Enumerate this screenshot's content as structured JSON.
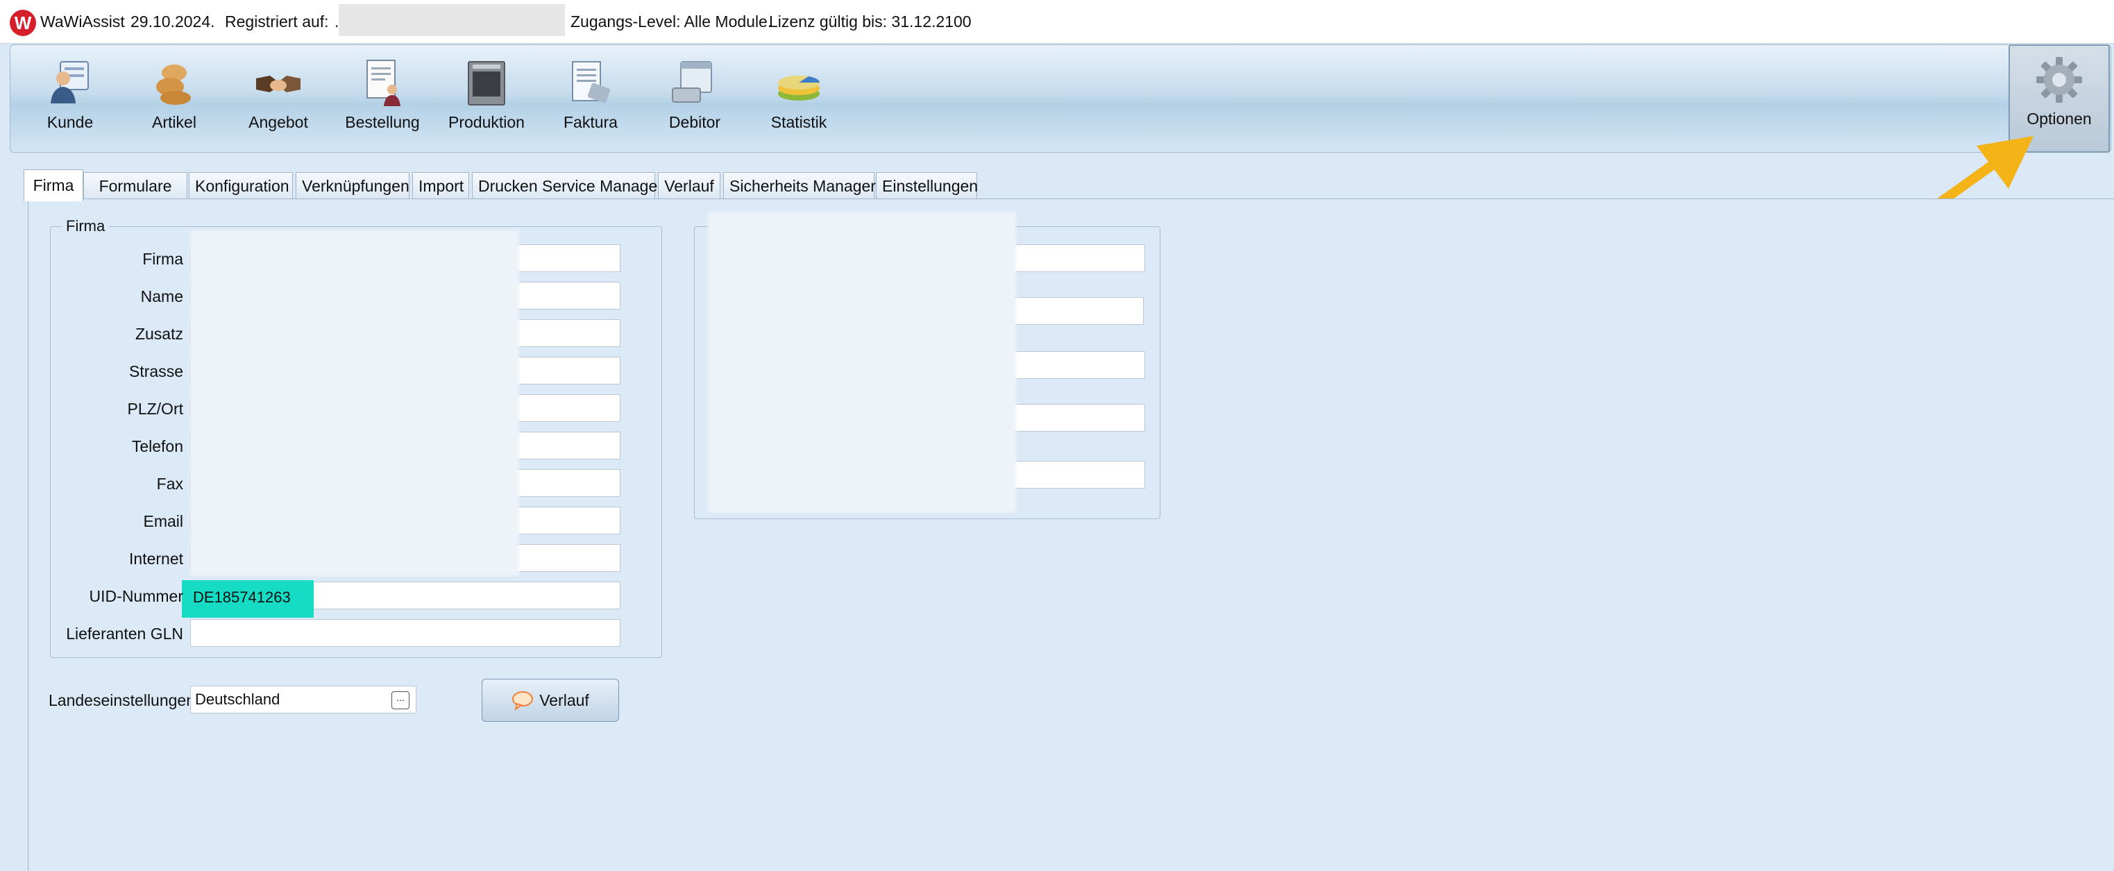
{
  "titlebar": {
    "app_name": "WaWiAssist",
    "date": "29.10.2024.",
    "registered_label": "Registriert auf:",
    "registered_value": ".",
    "access_label": "Zugangs-Level: Alle Module.",
    "license_label": "Lizenz gültig bis: 31.12.2100"
  },
  "ribbon": {
    "items": [
      {
        "label": "Kunde",
        "icon": "customer-icon"
      },
      {
        "label": "Artikel",
        "icon": "article-icon"
      },
      {
        "label": "Angebot",
        "icon": "handshake-icon"
      },
      {
        "label": "Bestellung",
        "icon": "order-icon"
      },
      {
        "label": "Produktion",
        "icon": "production-icon"
      },
      {
        "label": "Faktura",
        "icon": "invoice-icon"
      },
      {
        "label": "Debitor",
        "icon": "debtor-icon"
      },
      {
        "label": "Statistik",
        "icon": "statistics-icon"
      }
    ],
    "options_label": "Optionen"
  },
  "tabs": [
    {
      "label": "Firma",
      "active": true
    },
    {
      "label": "Formulare"
    },
    {
      "label": "Konfiguration"
    },
    {
      "label": "Verknüpfungen"
    },
    {
      "label": "Import"
    },
    {
      "label": "Drucken Service Manager"
    },
    {
      "label": "Verlauf"
    },
    {
      "label": "Sicherheits Manager"
    },
    {
      "label": "Einstellungen"
    }
  ],
  "firma_group": {
    "title": "Firma",
    "fields": [
      {
        "label": "Firma",
        "value": ""
      },
      {
        "label": "Name",
        "value": ""
      },
      {
        "label": "Zusatz",
        "value": ""
      },
      {
        "label": "Strasse",
        "value": ""
      },
      {
        "label": "PLZ/Ort",
        "value": ""
      },
      {
        "label": "Telefon",
        "value": ""
      },
      {
        "label": "Fax",
        "value": ""
      },
      {
        "label": "Email",
        "value": ""
      },
      {
        "label": "Internet",
        "value": ""
      },
      {
        "label": "UID-Nummer",
        "value": "DE185741263"
      },
      {
        "label": "Lieferanten GLN",
        "value": ""
      }
    ]
  },
  "landeseinstellungen": {
    "label": "Landeseinstellungen",
    "value": "Deutschland",
    "ellipsis": "..."
  },
  "verlauf_button": {
    "label": "Verlauf"
  },
  "colors": {
    "accent_arrow": "#f4b316",
    "uid_highlight": "#17dcc4",
    "logo_red": "#d51f2b"
  }
}
